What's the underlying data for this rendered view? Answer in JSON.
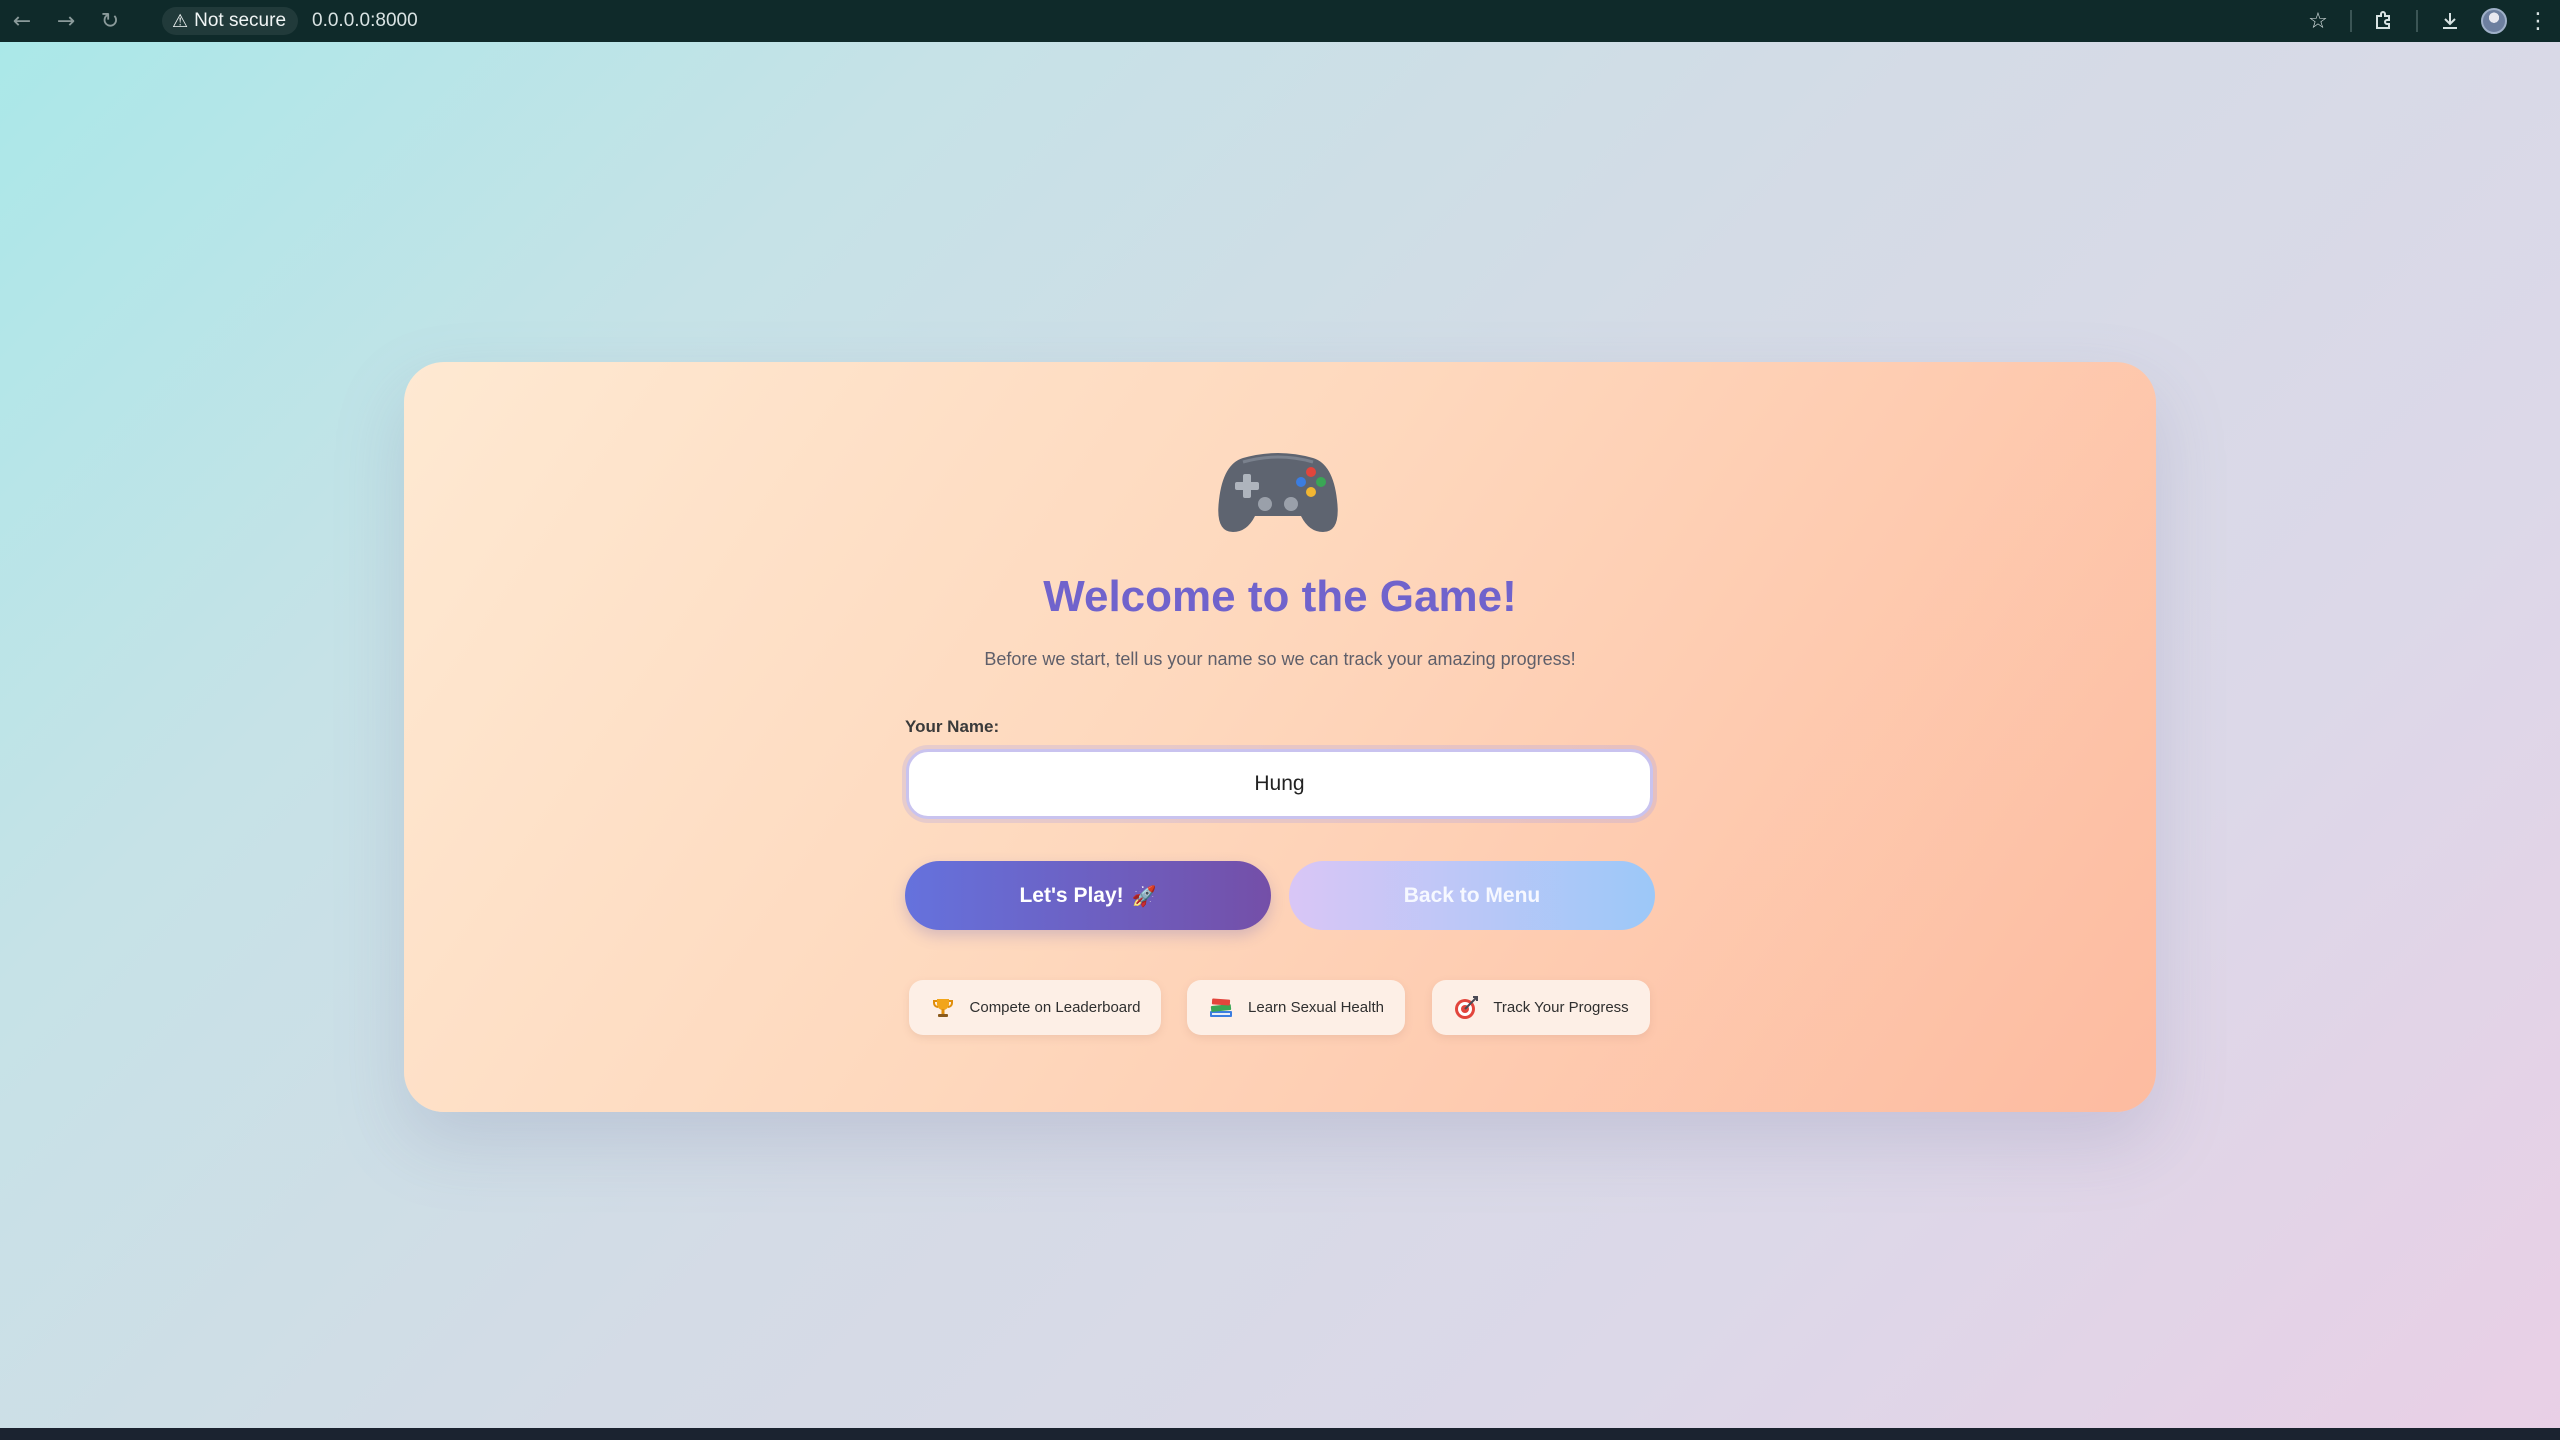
{
  "browser": {
    "security_label": "Not secure",
    "url": "0.0.0.0:8000"
  },
  "card": {
    "title": "Welcome to the Game!",
    "subtitle": "Before we start, tell us your name so we can track your amazing progress!",
    "name_label": "Your Name:",
    "name_value": "Hung",
    "play_label": "Let's Play!",
    "play_emoji": "🚀",
    "back_label": "Back to Menu",
    "features": [
      {
        "icon": "trophy-icon",
        "label": "Compete on Leaderboard"
      },
      {
        "icon": "books-icon",
        "label": "Learn Sexual Health"
      },
      {
        "icon": "target-icon",
        "label": "Track Your Progress"
      }
    ]
  },
  "colors": {
    "title": "#7063cc",
    "play_button_start": "#6572dd",
    "play_button_end": "#744fa8",
    "back_button_start": "#d9c6f6",
    "back_button_end": "#9cc8f8"
  }
}
